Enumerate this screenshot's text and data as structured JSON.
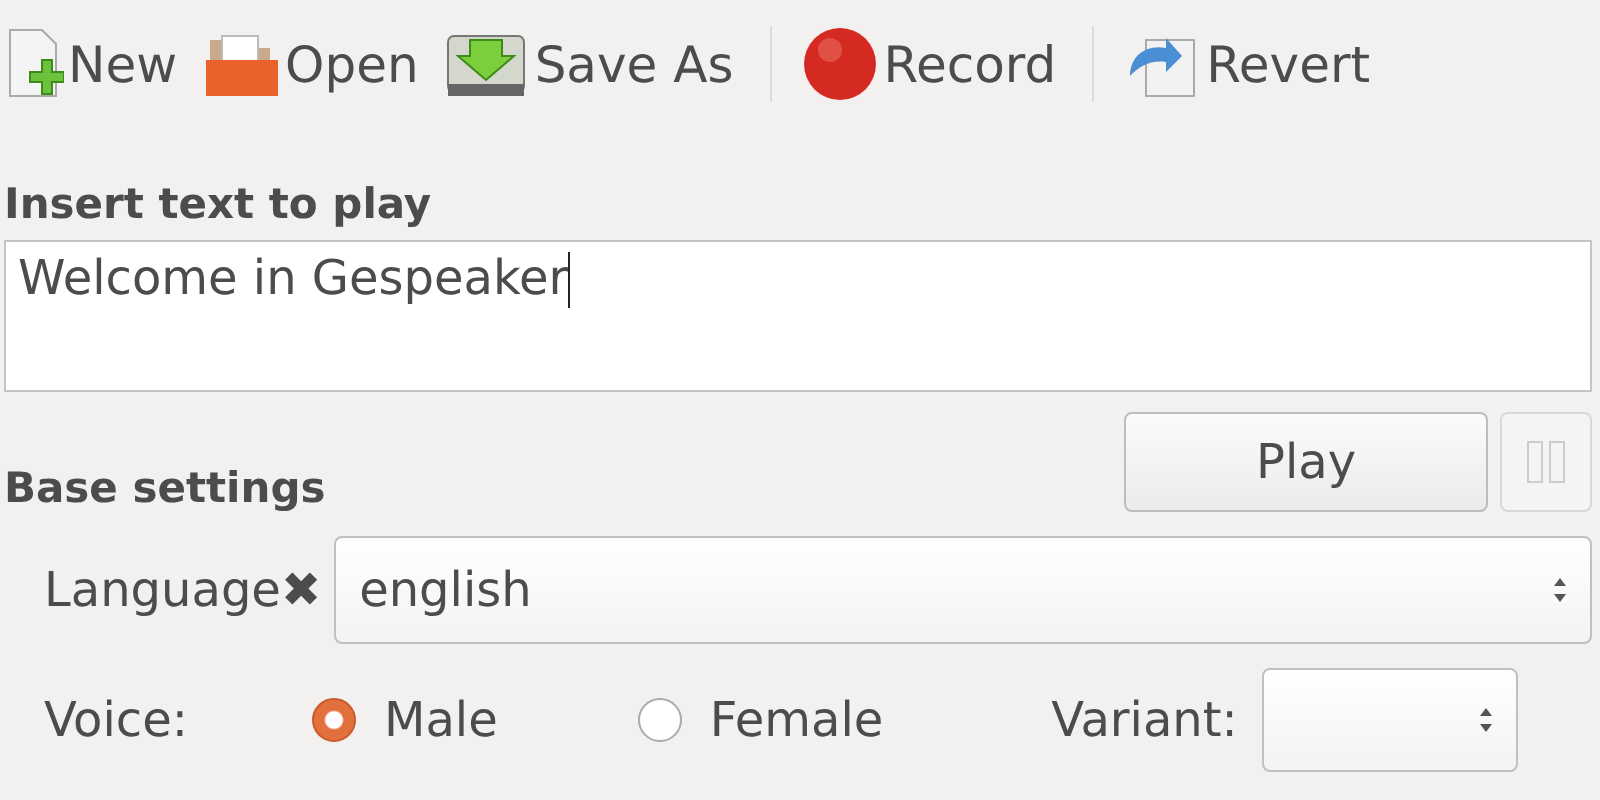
{
  "toolbar": [
    {
      "kind": "new",
      "label": "New"
    },
    {
      "kind": "open",
      "label": "Open"
    },
    {
      "kind": "save",
      "label": "Save As",
      "separator_after": true
    },
    {
      "kind": "record",
      "label": "Record",
      "separator_after": true
    },
    {
      "kind": "revert",
      "label": "Revert"
    }
  ],
  "text_section": {
    "heading": "Insert text to play",
    "value": "Welcome in Gespeaker"
  },
  "play_button": {
    "label": "Play"
  },
  "pause_button": {
    "disabled": true
  },
  "base_settings": {
    "heading": "Base settings",
    "language_label": "Language✖",
    "language_value": "english",
    "voice_label": "Voice:",
    "voices": [
      {
        "label": "Male",
        "selected": true
      },
      {
        "label": "Female",
        "selected": false
      }
    ],
    "variant_label": "Variant:"
  }
}
